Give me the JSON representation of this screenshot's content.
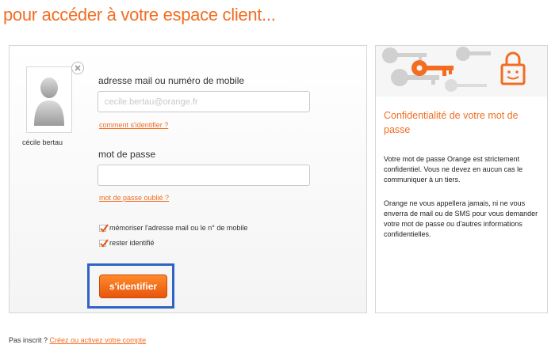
{
  "page": {
    "title": "pour accéder à votre espace client..."
  },
  "account": {
    "name": "cécile bertau"
  },
  "login_form": {
    "email_label": "adresse mail ou numéro de mobile",
    "email_value": "cecile.bertau@orange.fr",
    "identify_help_link": "comment s'identifier ?",
    "password_label": "mot de passe",
    "password_value": "",
    "forgot_password_link": "mot de passe oublié ?",
    "remember_label": "mémoriser l'adresse mail ou le n° de mobile",
    "remember_checked": true,
    "stay_connected_label": "rester identifié",
    "stay_connected_checked": true,
    "submit_label": "s'identifier"
  },
  "info_panel": {
    "title": "Confidentialité de votre mot de passe",
    "paragraph1": "Votre mot de passe Orange est strictement confidentiel. Vous ne devez en aucun cas le communiquer à un tiers.",
    "paragraph2": "Orange ne vous appellera jamais, ni ne vous enverra de mail ou de SMS pour vous demander votre mot de passe ou d'autres informations confidentielles."
  },
  "footer": {
    "signup_prompt": "Pas inscrit ?",
    "signup_link": "Créez ou activez votre compte"
  },
  "colors": {
    "brand_orange": "#f26d22",
    "highlight_blue": "#2f64c6"
  },
  "icons": [
    "user-silhouette-icon",
    "remove-account-icon",
    "checkmark-icon",
    "keys-icon",
    "lock-icon"
  ]
}
